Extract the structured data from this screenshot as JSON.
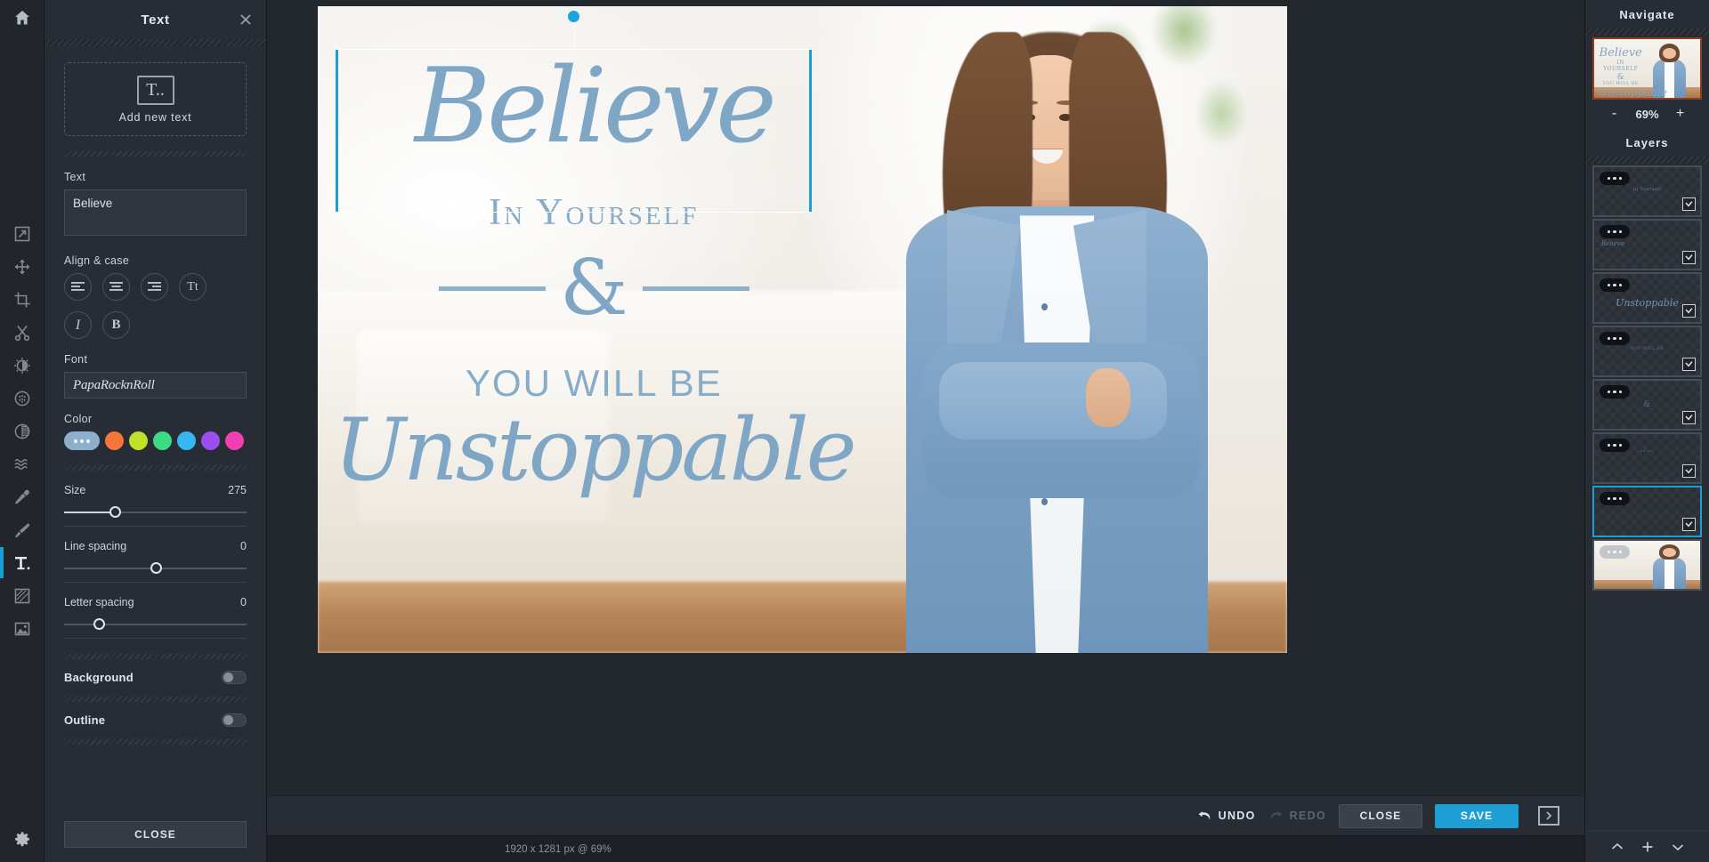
{
  "toolrail": {
    "home_label": "home-icon",
    "settings_label": "settings-icon",
    "tools": [
      {
        "name": "share",
        "label": "Share"
      },
      {
        "name": "move",
        "label": "Move"
      },
      {
        "name": "crop",
        "label": "Crop"
      },
      {
        "name": "cut",
        "label": "Cut"
      },
      {
        "name": "adjust",
        "label": "Adjust"
      },
      {
        "name": "effects",
        "label": "Effects"
      },
      {
        "name": "filters",
        "label": "Filters"
      },
      {
        "name": "liquify",
        "label": "Liquify"
      },
      {
        "name": "retouch",
        "label": "Retouch"
      },
      {
        "name": "brush",
        "label": "Brush"
      },
      {
        "name": "text",
        "label": "Text"
      },
      {
        "name": "texture",
        "label": "Texture"
      },
      {
        "name": "image",
        "label": "Image"
      }
    ],
    "active_tool": "text"
  },
  "panel": {
    "title": "Text",
    "close_icon": "close-icon",
    "add_new": {
      "glyph": "T..",
      "label": "Add new text"
    },
    "text_field": {
      "label": "Text",
      "value": "Believe"
    },
    "align_case": {
      "label": "Align & case",
      "buttons": [
        {
          "name": "align-left",
          "glyph": "left"
        },
        {
          "name": "align-center",
          "glyph": "center"
        },
        {
          "name": "align-right",
          "glyph": "right"
        },
        {
          "name": "text-case",
          "glyph": "Tt"
        },
        {
          "name": "italic",
          "glyph": "I"
        },
        {
          "name": "bold",
          "glyph": "B"
        }
      ]
    },
    "font": {
      "label": "Font",
      "value": "PapaRocknRoll"
    },
    "color": {
      "label": "Color",
      "selected": "#8cb0cc",
      "swatches": [
        "#8cb0cc",
        "#f5763a",
        "#c0e226",
        "#3ddc84",
        "#36b7ef",
        "#9b4ff0",
        "#f03fb0"
      ]
    },
    "size": {
      "label": "Size",
      "value": "275",
      "percent": 28
    },
    "line_spacing": {
      "label": "Line spacing",
      "value": "0",
      "percent": 50
    },
    "letter_spacing": {
      "label": "Letter spacing",
      "value": "0",
      "percent": 19
    },
    "background": {
      "label": "Background",
      "on": false
    },
    "outline": {
      "label": "Outline",
      "on": false
    },
    "close_button": "CLOSE"
  },
  "canvas": {
    "status": "1920 x 1281 px @ 69%",
    "artwork": {
      "line1": "Believe",
      "line2": "In Yourself",
      "line3": "&",
      "line4": "YOU WILL BE",
      "line5": "Unstoppable"
    },
    "selection": {
      "handle": "rotate-handle"
    }
  },
  "bottombar": {
    "undo": "UNDO",
    "redo": "REDO",
    "close": "CLOSE",
    "save": "SAVE",
    "expand_icon": "expand-panel-icon"
  },
  "right": {
    "navigate_title": "Navigate",
    "zoom_out": "-",
    "zoom_value": "69%",
    "zoom_in": "+",
    "layers_title": "Layers",
    "layers": [
      {
        "name": "layer-1",
        "mini": "In Yourself",
        "type": "text",
        "selected": false
      },
      {
        "name": "layer-2",
        "mini": "Believe",
        "type": "text",
        "selected": false
      },
      {
        "name": "layer-3",
        "mini": "Unstoppable",
        "type": "text",
        "selected": false
      },
      {
        "name": "layer-4",
        "mini": "YOU WILL BE",
        "type": "text",
        "selected": false
      },
      {
        "name": "layer-5",
        "mini": "&",
        "type": "text",
        "selected": false
      },
      {
        "name": "layer-6",
        "mini": "rules",
        "type": "text",
        "selected": false
      },
      {
        "name": "layer-7",
        "mini": "",
        "type": "text",
        "selected": true
      },
      {
        "name": "layer-8",
        "mini": "",
        "type": "photo",
        "selected": false
      }
    ],
    "nav": {
      "up": "move-layer-up",
      "add": "add-layer",
      "down": "move-layer-down"
    }
  }
}
